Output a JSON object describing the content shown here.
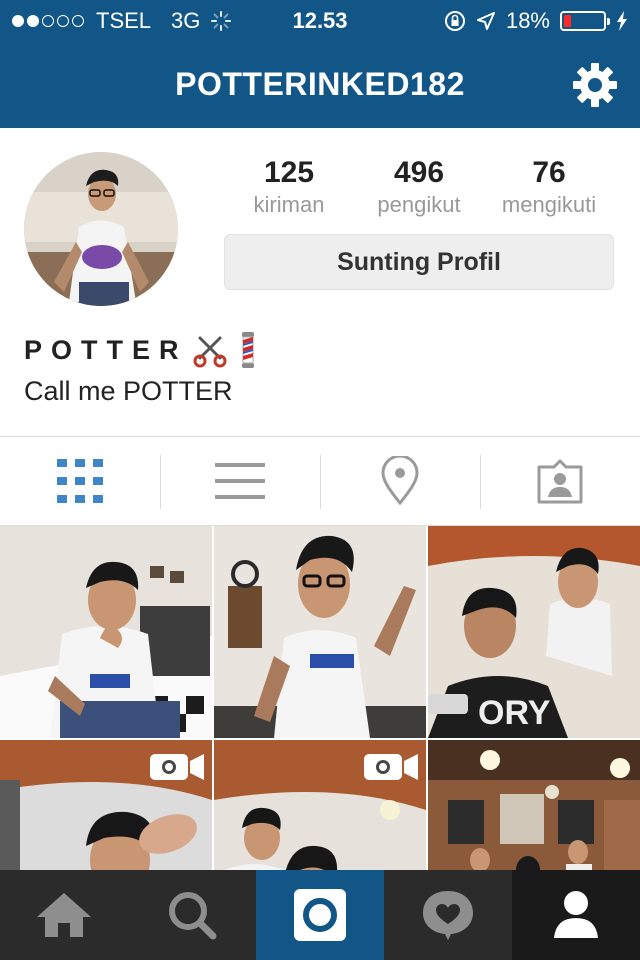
{
  "status_bar": {
    "signal_dots": "●●○○○",
    "carrier": "TSEL",
    "network": "3G",
    "time": "12.53",
    "battery_percent": "18%",
    "battery_level": 0.18,
    "battery_color": "#ff2a2a"
  },
  "header": {
    "username": "POTTERINKED182",
    "settings_icon": "gear-icon",
    "background": "#125688"
  },
  "profile": {
    "stats": [
      {
        "count": "125",
        "label": "kiriman"
      },
      {
        "count": "496",
        "label": "pengikut"
      },
      {
        "count": "76",
        "label": "mengikuti"
      }
    ],
    "edit_button": "Sunting Profil",
    "display_name": "POTTER",
    "name_emoji": [
      "scissors-emoji",
      "barber-pole-emoji"
    ],
    "bio": "Call me POTTER"
  },
  "view_tabs": [
    {
      "icon": "grid-icon",
      "active": true
    },
    {
      "icon": "list-icon",
      "active": false
    },
    {
      "icon": "location-pin-icon",
      "active": false
    },
    {
      "icon": "tagged-photos-icon",
      "active": false
    }
  ],
  "grid_posts": [
    {
      "type": "photo"
    },
    {
      "type": "photo"
    },
    {
      "type": "photo"
    },
    {
      "type": "video"
    },
    {
      "type": "video"
    },
    {
      "type": "photo"
    }
  ],
  "bottom_nav": [
    {
      "icon": "home-icon"
    },
    {
      "icon": "search-icon"
    },
    {
      "icon": "camera-icon",
      "active_color": "#125688"
    },
    {
      "icon": "activity-heart-icon"
    },
    {
      "icon": "profile-icon",
      "selected": true
    }
  ]
}
